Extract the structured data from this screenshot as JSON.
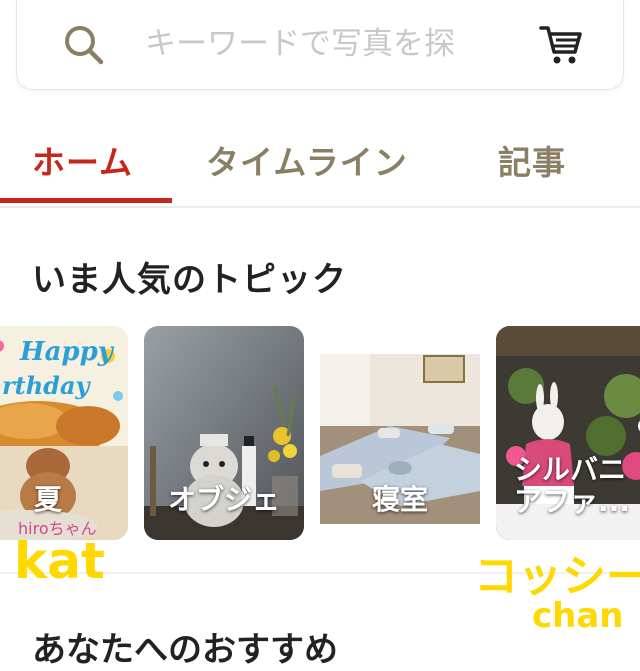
{
  "search": {
    "placeholder": "キーワードで写真を探",
    "icon": "search-icon",
    "cart_icon": "cart-icon"
  },
  "tabs": [
    {
      "label": "ホーム",
      "active": true
    },
    {
      "label": "タイムライン",
      "active": false
    },
    {
      "label": "記事",
      "active": false
    }
  ],
  "section_title": "いま人気のトピック",
  "topics": [
    {
      "label": "夏",
      "image_text_top": "Happy",
      "image_text_mid": "rthday",
      "image_text_credit": "hiroちゃん"
    },
    {
      "label": "オブジェ"
    },
    {
      "label": "寝室"
    },
    {
      "label": "シルバニ\nアファ..."
    }
  ],
  "overlays": {
    "kat": "kat",
    "kossie": "コッシー",
    "chan": "chan"
  },
  "next_section_title": "あなたへのおすすめ",
  "colors": {
    "accent": "#c7261c",
    "tab_inactive": "#8a7f62",
    "placeholder": "#c8c8c8",
    "overlay_yellow": "#ffd800"
  }
}
